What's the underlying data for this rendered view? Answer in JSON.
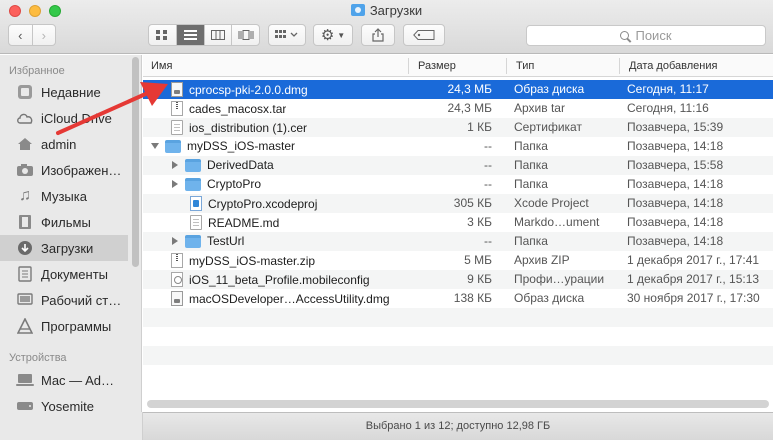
{
  "window": {
    "title": "Загрузки"
  },
  "toolbar": {
    "back_icon": "‹",
    "forward_icon": "›",
    "search_placeholder": "Поиск"
  },
  "sidebar": {
    "favorites_header": "Избранное",
    "devices_header": "Устройства",
    "items": [
      {
        "label": "Недавние",
        "icon": "clock-icon"
      },
      {
        "label": "iCloud Drive",
        "icon": "cloud-icon"
      },
      {
        "label": "admin",
        "icon": "home-icon"
      },
      {
        "label": "Изображен…",
        "icon": "camera-icon"
      },
      {
        "label": "Музыка",
        "icon": "music-icon"
      },
      {
        "label": "Фильмы",
        "icon": "film-icon"
      },
      {
        "label": "Загрузки",
        "icon": "download-icon",
        "selected": true
      },
      {
        "label": "Документы",
        "icon": "document-icon"
      },
      {
        "label": "Рабочий ст…",
        "icon": "desktop-icon"
      },
      {
        "label": "Программы",
        "icon": "apps-icon"
      }
    ],
    "devices": [
      {
        "label": "Mac — Ad…",
        "icon": "computer-icon"
      },
      {
        "label": "Yosemite",
        "icon": "disk-icon"
      }
    ]
  },
  "columns": {
    "name": "Имя",
    "size": "Размер",
    "kind": "Тип",
    "date": "Дата добавления"
  },
  "files": [
    {
      "name": "cprocsp-pki-2.0.0.dmg",
      "size": "24,3 МБ",
      "kind": "Образ диска",
      "date": "Сегодня, 11:17"
    },
    {
      "name": "cades_macosx.tar",
      "size": "24,3 МБ",
      "kind": "Архив tar",
      "date": "Сегодня, 11:16"
    },
    {
      "name": "ios_distribution (1).cer",
      "size": "1 КБ",
      "kind": "Сертификат",
      "date": "Позавчера, 15:39"
    },
    {
      "name": "myDSS_iOS-master",
      "size": "--",
      "kind": "Папка",
      "date": "Позавчера, 14:18"
    },
    {
      "name": "DerivedData",
      "size": "--",
      "kind": "Папка",
      "date": "Позавчера, 15:58"
    },
    {
      "name": "CryptoPro",
      "size": "--",
      "kind": "Папка",
      "date": "Позавчера, 14:18"
    },
    {
      "name": "CryptoPro.xcodeproj",
      "size": "305 КБ",
      "kind": "Xcode Project",
      "date": "Позавчера, 14:18"
    },
    {
      "name": "README.md",
      "size": "3 КБ",
      "kind": "Markdo…ument",
      "date": "Позавчера, 14:18"
    },
    {
      "name": "TestUrl",
      "size": "--",
      "kind": "Папка",
      "date": "Позавчера, 14:18"
    },
    {
      "name": "myDSS_iOS-master.zip",
      "size": "5 МБ",
      "kind": "Архив ZIP",
      "date": "1 декабря 2017 г., 17:41"
    },
    {
      "name": "iOS_11_beta_Profile.mobileconfig",
      "size": "9 КБ",
      "kind": "Профи…урации",
      "date": "1 декабря 2017 г., 15:13"
    },
    {
      "name": "macOSDeveloper…AccessUtility.dmg",
      "size": "138 КБ",
      "kind": "Образ диска",
      "date": "30 ноября 2017 г., 17:30"
    }
  ],
  "status": {
    "text": "Выбрано 1 из 12; доступно 12,98 ГБ"
  },
  "colors": {
    "selection": "#1a6ad9",
    "arrow": "#e53935"
  }
}
